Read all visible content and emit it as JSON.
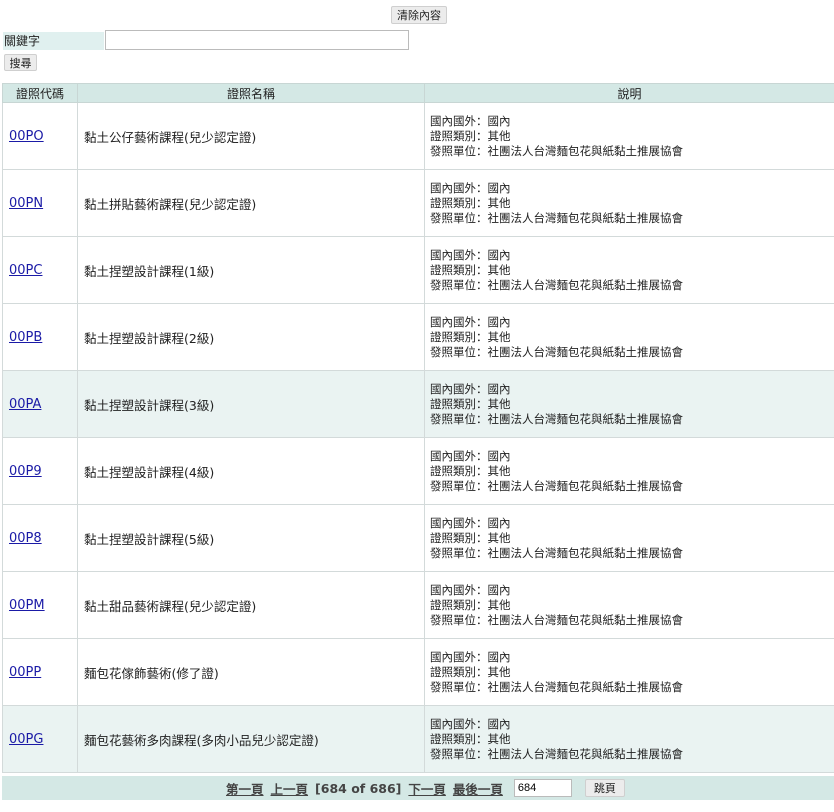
{
  "top": {
    "clear_label": "清除內容"
  },
  "search": {
    "keyword_label": "關鍵字",
    "keyword_value": "",
    "search_label": "搜尋"
  },
  "table": {
    "headers": [
      "證照代碼",
      "證照名稱",
      "說明"
    ],
    "rows": [
      {
        "code": "00PO",
        "name": "黏土公仔藝術課程(兒少認定證)",
        "desc": [
          "國內國外：國內",
          "證照類別：其他",
          "發照單位：社團法人台灣麵包花與紙黏土推展協會"
        ]
      },
      {
        "code": "00PN",
        "name": "黏土拼貼藝術課程(兒少認定證)",
        "desc": [
          "國內國外：國內",
          "證照類別：其他",
          "發照單位：社團法人台灣麵包花與紙黏土推展協會"
        ]
      },
      {
        "code": "00PC",
        "name": "黏土捏塑設計課程(1級)",
        "desc": [
          "國內國外：國內",
          "證照類別：其他",
          "發照單位：社團法人台灣麵包花與紙黏土推展協會"
        ]
      },
      {
        "code": "00PB",
        "name": "黏土捏塑設計課程(2級)",
        "desc": [
          "國內國外：國內",
          "證照類別：其他",
          "發照單位：社團法人台灣麵包花與紙黏土推展協會"
        ]
      },
      {
        "code": "00PA",
        "name": "黏土捏塑設計課程(3級)",
        "desc": [
          "國內國外：國內",
          "證照類別：其他",
          "發照單位：社團法人台灣麵包花與紙黏土推展協會"
        ]
      },
      {
        "code": "00P9",
        "name": "黏土捏塑設計課程(4級)",
        "desc": [
          "國內國外：國內",
          "證照類別：其他",
          "發照單位：社團法人台灣麵包花與紙黏土推展協會"
        ]
      },
      {
        "code": "00P8",
        "name": "黏土捏塑設計課程(5級)",
        "desc": [
          "國內國外：國內",
          "證照類別：其他",
          "發照單位：社團法人台灣麵包花與紙黏土推展協會"
        ]
      },
      {
        "code": "00PM",
        "name": "黏土甜品藝術課程(兒少認定證)",
        "desc": [
          "國內國外：國內",
          "證照類別：其他",
          "發照單位：社團法人台灣麵包花與紙黏土推展協會"
        ]
      },
      {
        "code": "00PP",
        "name": "麵包花傢飾藝術(修了證)",
        "desc": [
          "國內國外：國內",
          "證照類別：其他",
          "發照單位：社團法人台灣麵包花與紙黏土推展協會"
        ]
      },
      {
        "code": "00PG",
        "name": "麵包花藝術多肉課程(多肉小品兒少認定證)",
        "desc": [
          "國內國外：國內",
          "證照類別：其他",
          "發照單位：社團法人台灣麵包花與紙黏土推展協會"
        ]
      }
    ]
  },
  "pager": {
    "first": "第一頁",
    "prev": "上一頁",
    "info": "[684 of 686]",
    "next": "下一頁",
    "last": "最後一頁",
    "page_value": "684",
    "jump_label": "跳頁"
  }
}
